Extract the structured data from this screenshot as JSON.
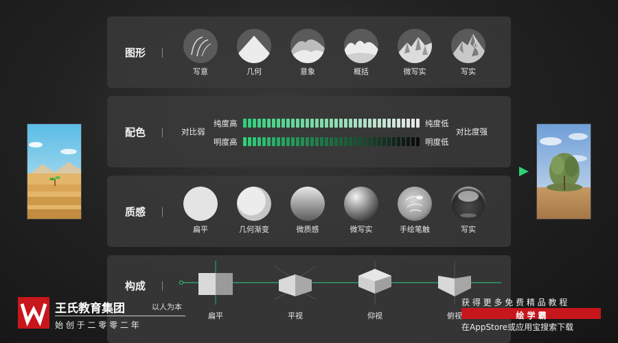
{
  "rows": {
    "shape": {
      "label": "图形",
      "items": [
        "写意",
        "几何",
        "意象",
        "概括",
        "微写实",
        "写实"
      ]
    },
    "color": {
      "label": "配色",
      "left_label": "对比弱",
      "right_label": "对比度强",
      "saturation_high": "纯度高",
      "saturation_low": "纯度低",
      "brightness_high": "明度高",
      "brightness_low": "明度低"
    },
    "texture": {
      "label": "质感",
      "items": [
        "扁平",
        "几何渐变",
        "微质感",
        "微写实",
        "手绘笔触",
        "写实"
      ]
    },
    "composition": {
      "label": "构成",
      "items": [
        "扁平",
        "平视",
        "仰视",
        "俯视"
      ]
    }
  },
  "brand": {
    "name": "王氏教育集团",
    "slogan": "以人为本",
    "founded": "始 创 于 二 零 零 二 年"
  },
  "promo": {
    "line1": "获 得 更 多 免 费 精 品 教 程",
    "app_name": "绘 学 霸",
    "line2": "在AppStore或应用宝搜索下载"
  },
  "colors": {
    "accent_green": "#2fd17a",
    "panel_bg": "#3a3a3a",
    "brand_red": "#c8161d"
  }
}
